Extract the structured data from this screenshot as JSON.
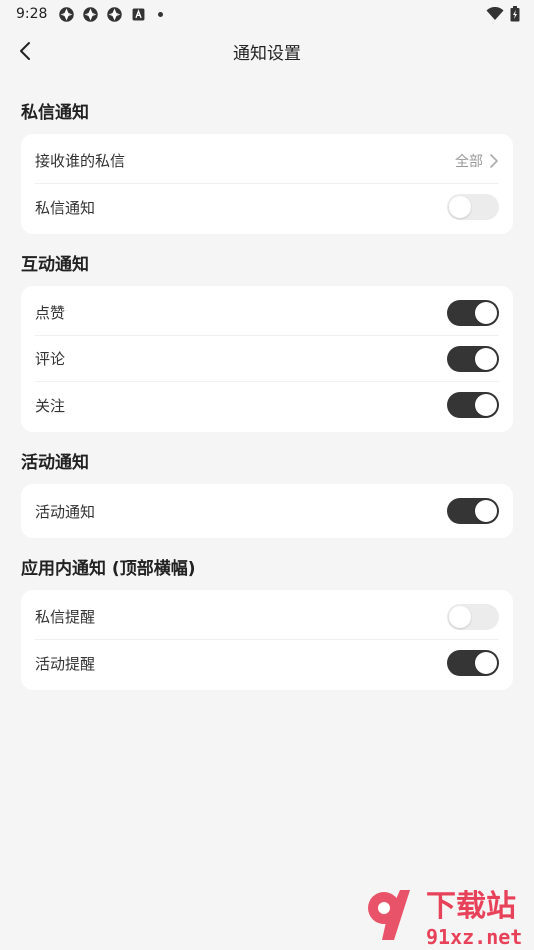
{
  "status_bar": {
    "time": "9:28"
  },
  "nav": {
    "title": "通知设置"
  },
  "sections": [
    {
      "title": "私信通知",
      "rows": [
        {
          "label": "接收谁的私信",
          "value": "全部",
          "type": "link"
        },
        {
          "label": "私信通知",
          "type": "toggle",
          "on": false
        }
      ]
    },
    {
      "title": "互动通知",
      "rows": [
        {
          "label": "点赞",
          "type": "toggle",
          "on": true
        },
        {
          "label": "评论",
          "type": "toggle",
          "on": true
        },
        {
          "label": "关注",
          "type": "toggle",
          "on": true
        }
      ]
    },
    {
      "title": "活动通知",
      "rows": [
        {
          "label": "活动通知",
          "type": "toggle",
          "on": true
        }
      ]
    },
    {
      "title": "应用内通知 (顶部横幅)",
      "rows": [
        {
          "label": "私信提醒",
          "type": "toggle",
          "on": false
        },
        {
          "label": "活动提醒",
          "type": "toggle",
          "on": true
        }
      ]
    }
  ],
  "colors": {
    "toggle_on": "#353535",
    "toggle_off": "#ececec",
    "background": "#f5f5f5",
    "watermark": "#e8425a"
  },
  "watermark": {
    "brand": "下载站",
    "domain": "91xz.net"
  }
}
